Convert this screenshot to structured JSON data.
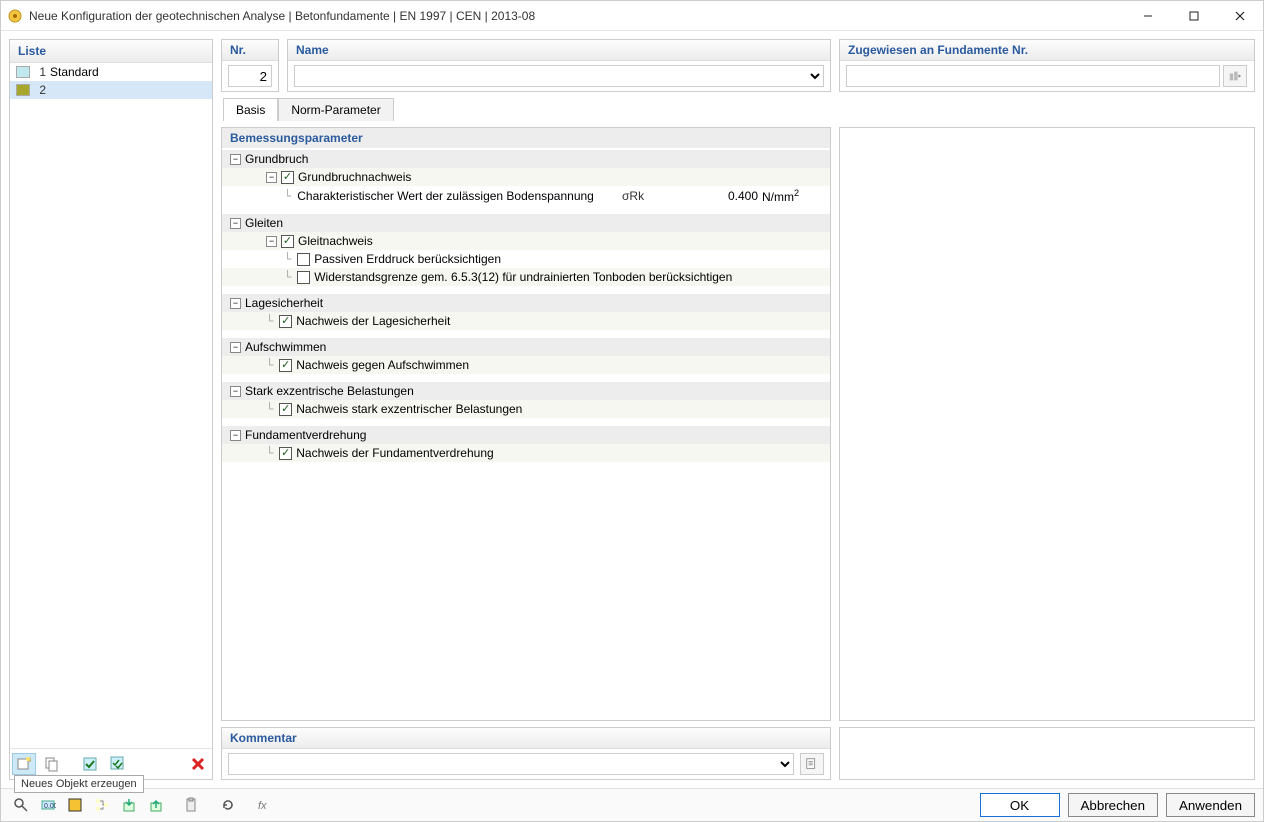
{
  "window": {
    "title": "Neue Konfiguration der geotechnischen Analyse | Betonfundamente | EN 1997 | CEN | 2013-08"
  },
  "sidebar": {
    "header": "Liste",
    "items": [
      {
        "num": "1",
        "label": "Standard",
        "swatch": "#bfe8ef"
      },
      {
        "num": "2",
        "label": "",
        "swatch": "#a7a72c"
      }
    ],
    "tooltip": "Neues Objekt erzeugen"
  },
  "fields": {
    "nr_label": "Nr.",
    "nr_value": "2",
    "name_label": "Name",
    "name_value": "",
    "assign_label": "Zugewiesen an Fundamente Nr.",
    "assign_value": ""
  },
  "tabs": {
    "basis": "Basis",
    "norm": "Norm-Parameter"
  },
  "params": {
    "section_title": "Bemessungsparameter",
    "groups": [
      {
        "title": "Grundbruch",
        "rows": [
          {
            "type": "check",
            "checked": true,
            "label": "Grundbruchnachweis",
            "indent": 2,
            "expander": true
          },
          {
            "type": "param",
            "label": "Charakteristischer Wert der zulässigen Bodenspannung",
            "symbol": "σRk",
            "value": "0.400",
            "unit_html": "N/mm²",
            "indent": 3
          }
        ]
      },
      {
        "title": "Gleiten",
        "rows": [
          {
            "type": "check",
            "checked": true,
            "label": "Gleitnachweis",
            "indent": 2,
            "expander": true
          },
          {
            "type": "check",
            "checked": false,
            "label": "Passiven Erddruck berücksichtigen",
            "indent": 3
          },
          {
            "type": "check",
            "checked": false,
            "label": "Widerstandsgrenze gem. 6.5.3(12) für undrainierten Tonboden berücksichtigen",
            "indent": 3
          }
        ]
      },
      {
        "title": "Lagesicherheit",
        "rows": [
          {
            "type": "check",
            "checked": true,
            "label": "Nachweis der Lagesicherheit",
            "indent": 2
          }
        ]
      },
      {
        "title": "Aufschwimmen",
        "rows": [
          {
            "type": "check",
            "checked": true,
            "label": "Nachweis gegen Aufschwimmen",
            "indent": 2
          }
        ]
      },
      {
        "title": "Stark exzentrische Belastungen",
        "rows": [
          {
            "type": "check",
            "checked": true,
            "label": "Nachweis stark exzentrischer Belastungen",
            "indent": 2
          }
        ]
      },
      {
        "title": "Fundamentverdrehung",
        "rows": [
          {
            "type": "check",
            "checked": true,
            "label": "Nachweis der Fundamentverdrehung",
            "indent": 2
          }
        ]
      }
    ]
  },
  "comment": {
    "header": "Kommentar",
    "value": ""
  },
  "buttons": {
    "ok": "OK",
    "cancel": "Abbrechen",
    "apply": "Anwenden"
  }
}
